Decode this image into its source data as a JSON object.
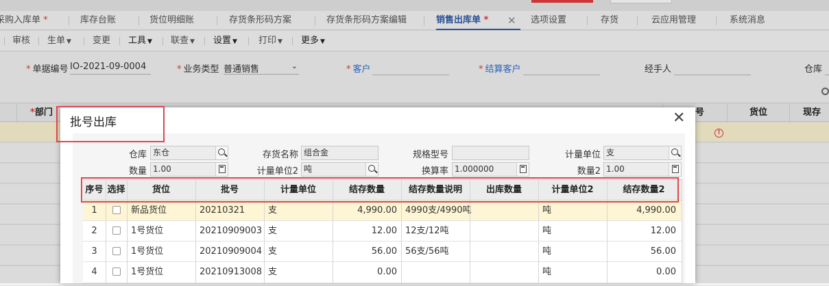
{
  "tabs": [
    {
      "label": "采购入库单",
      "modified": true
    },
    {
      "label": "库存台账"
    },
    {
      "label": "货位明细账"
    },
    {
      "label": "存货条形码方案"
    },
    {
      "label": "存货条形码方案编辑"
    },
    {
      "label": "销售出库单",
      "modified": true,
      "active": true,
      "close": "✕"
    },
    {
      "label": "选项设置"
    },
    {
      "label": "存货"
    },
    {
      "label": "云应用管理"
    },
    {
      "label": "系统消息"
    }
  ],
  "toolbar": {
    "review": "审核",
    "generate": "生单",
    "change": "变更",
    "tools": "工具",
    "link": "联查",
    "settings": "设置",
    "print": "打印",
    "more": "更多"
  },
  "form": {
    "doc_no_label": "单据编号",
    "doc_no": "IO-2021-09-0004",
    "biz_type_label": "业务类型",
    "biz_type": "普通销售",
    "customer_label": "客户",
    "settle_customer_label": "结算客户",
    "handler_label": "经手人",
    "warehouse_label": "仓库"
  },
  "grid": {
    "headers": {
      "dept": "部门",
      "num_tail": "号",
      "location": "货位",
      "stock": "现存量"
    }
  },
  "colors": {
    "accent": "#2e5aa8",
    "required": "#e4393c",
    "highlight_box": "#e0454b",
    "selected_row": "#fdf5d3"
  },
  "modal": {
    "title": "批号出库",
    "close": "✕",
    "fields": {
      "warehouse_label": "仓库",
      "warehouse": "东仓",
      "item_name_label": "存货名称",
      "item_name": "组合金",
      "spec_label": "规格型号",
      "spec": "",
      "unit_label": "计量单位",
      "unit": "支",
      "qty_label": "数量",
      "qty": "1.00",
      "unit2_label": "计量单位2",
      "unit2": "吨",
      "rate_label": "换算率",
      "rate": "1.000000",
      "qty2_label": "数量2",
      "qty2": "1.00"
    },
    "table": {
      "headers": [
        "序号",
        "选择",
        "货位",
        "批号",
        "计量单位",
        "结存数量",
        "结存数量说明",
        "出库数量",
        "计量单位2",
        "结存数量2"
      ],
      "rows": [
        {
          "no": "1",
          "location": "新品货位",
          "batch": "20210321",
          "unit": "支",
          "balance": "4,990.00",
          "desc": "4990支/4990吨",
          "out_qty": "",
          "unit2": "吨",
          "balance2": "4,990.00"
        },
        {
          "no": "2",
          "location": "1号货位",
          "batch": "20210909003",
          "unit": "支",
          "balance": "12.00",
          "desc": "12支/12吨",
          "out_qty": "",
          "unit2": "吨",
          "balance2": "12.00"
        },
        {
          "no": "3",
          "location": "1号货位",
          "batch": "20210909004",
          "unit": "支",
          "balance": "56.00",
          "desc": "56支/56吨",
          "out_qty": "",
          "unit2": "吨",
          "balance2": "56.00"
        },
        {
          "no": "4",
          "location": "1号货位",
          "batch": "20210913008",
          "unit": "支",
          "balance": "0.00",
          "desc": "",
          "out_qty": "",
          "unit2": "吨",
          "balance2": "0.00"
        }
      ]
    }
  }
}
